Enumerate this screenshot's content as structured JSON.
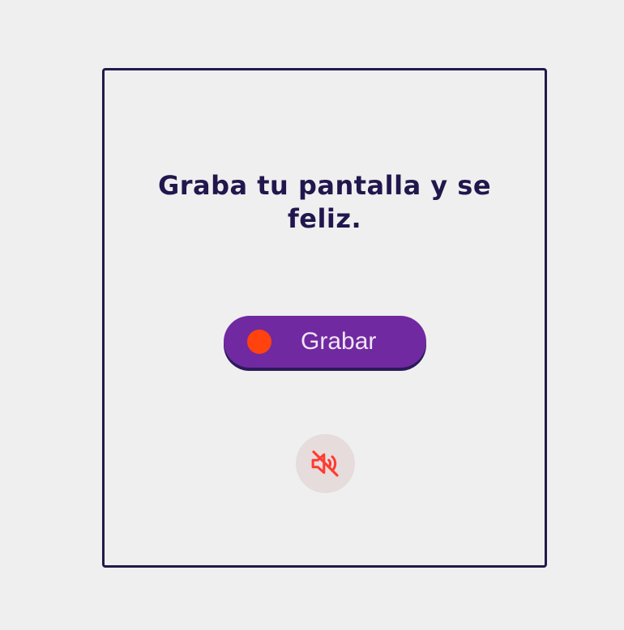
{
  "card": {
    "title": "Graba tu pantalla y se feliz."
  },
  "record_button": {
    "label": "Grabar",
    "icon": "record-dot-icon"
  },
  "audio_button": {
    "icon": "volume-muted-icon"
  },
  "colors": {
    "background": "#efefef",
    "card_border": "#221a4a",
    "title": "#21174d",
    "button": "#7029a0",
    "button_shadow": "#2a1a5a",
    "record_dot": "#ff420e",
    "button_text": "#efe6f4",
    "mute_bg": "#e5dcdb",
    "mute_icon": "#ff3b30"
  }
}
